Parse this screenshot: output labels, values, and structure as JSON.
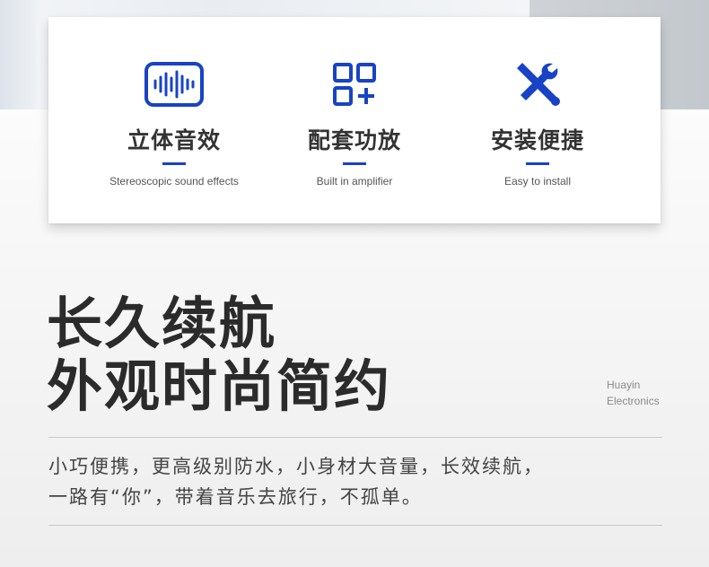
{
  "accent_color": "#1843c6",
  "features": [
    {
      "icon": "sound-wave-icon",
      "title": "立体音效",
      "subtitle": "Stereoscopic sound effects"
    },
    {
      "icon": "grid-plus-icon",
      "title": "配套功放",
      "subtitle": "Built in amplifier"
    },
    {
      "icon": "tools-icon",
      "title": "安装便捷",
      "subtitle": "Easy to install"
    }
  ],
  "headline": {
    "line1": "长久续航",
    "line2": "外观时尚简约"
  },
  "brand": {
    "line1": "Huayin",
    "line2": "Electronics"
  },
  "description": {
    "line1": "小巧便携，更高级别防水，小身材大音量，长效续航，",
    "line2": "一路有“你”，带着音乐去旅行，不孤单。"
  }
}
